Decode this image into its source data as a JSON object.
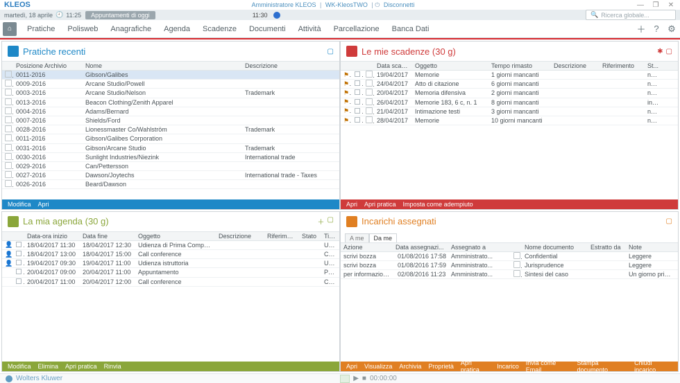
{
  "brand": "KLEOS",
  "topcenter": {
    "admin": "Amministratore KLEOS",
    "ws": "WK-KleosTWO",
    "disconnect": "Disconnetti",
    "disconnect_icon": "⏻"
  },
  "bar2": {
    "date": "martedì, 18 aprile",
    "clock_icon": "🕘",
    "time": "11:25",
    "pill": "Appuntamenti di oggi",
    "time2": "11:30",
    "search_placeholder": "Ricerca globale..."
  },
  "menu": [
    "Pratiche",
    "Polisweb",
    "Anagrafiche",
    "Agenda",
    "Scadenze",
    "Documenti",
    "Attività",
    "Parcellazione",
    "Banca Dati"
  ],
  "panel_recent": {
    "title": "Pratiche recenti",
    "cols": [
      "Posizione Archivio",
      "Nome",
      "Descrizione"
    ],
    "rows": [
      {
        "a": "0011-2016",
        "b": "Gibson/Galibes",
        "c": "",
        "sel": true
      },
      {
        "a": "0009-2016",
        "b": "Arcane Studio/Powell",
        "c": ""
      },
      {
        "a": "0003-2016",
        "b": "Arcane Studio/Nelson",
        "c": "Trademark"
      },
      {
        "a": "0013-2016",
        "b": "Beacon Clothing/Zenith Apparel",
        "c": ""
      },
      {
        "a": "0004-2016",
        "b": "Adams/Bernard",
        "c": ""
      },
      {
        "a": "0007-2016",
        "b": "Shields/Ford",
        "c": ""
      },
      {
        "a": "0028-2016",
        "b": "Lionessmaster Co/Wahlström",
        "c": "Trademark"
      },
      {
        "a": "0011-2016",
        "b": "Gibson/Galibes Corporation",
        "c": ""
      },
      {
        "a": "0031-2016",
        "b": "Gibson/Arcane Studio",
        "c": "Trademark"
      },
      {
        "a": "0030-2016",
        "b": "Sunlight Industries/Niezink",
        "c": "International trade"
      },
      {
        "a": "0029-2016",
        "b": "Can/Pettersson",
        "c": ""
      },
      {
        "a": "0027-2016",
        "b": "Dawson/Joytechs",
        "c": "International trade - Taxes"
      },
      {
        "a": "0026-2016",
        "b": "Beard/Dawson",
        "c": ""
      }
    ],
    "foot": [
      "Modifica",
      "Apri"
    ]
  },
  "panel_deadlines": {
    "title": "Le mie scadenze (30 g)",
    "cols": [
      "Data scad...",
      "Oggetto",
      "Tempo rimasto",
      "Descrizione",
      "Riferimento",
      "St..."
    ],
    "rows": [
      {
        "d": "19/04/2017",
        "o": "Memorie",
        "t": "1 giorni mancanti",
        "s": "no..."
      },
      {
        "d": "24/04/2017",
        "o": "Atto di citazione",
        "t": "6 giorni mancanti",
        "s": "no..."
      },
      {
        "d": "20/04/2017",
        "o": "Memoria difensiva",
        "t": "2 giorni mancanti",
        "s": "no..."
      },
      {
        "d": "26/04/2017",
        "o": "Memorie 183, 6 c, n. 1",
        "t": "8 giorni mancanti",
        "s": "in c..."
      },
      {
        "d": "21/04/2017",
        "o": "Intimazione testi",
        "t": "3 giorni mancanti",
        "s": "no..."
      },
      {
        "d": "28/04/2017",
        "o": "Memorie",
        "t": "10 giorni mancanti",
        "s": "no..."
      }
    ],
    "foot": [
      "Apri",
      "Apri pratica",
      "Imposta come adempiuto"
    ]
  },
  "panel_agenda": {
    "title": "La mia agenda (30 g)",
    "cols": [
      "Data-ora inizio",
      "Data fine",
      "Oggetto",
      "Descrizione",
      "Riferimento",
      "Stato",
      "Tip..."
    ],
    "rows": [
      {
        "a": "18/04/2017 11:30",
        "b": "18/04/2017 12:30",
        "c": "Udienza di Prima Comparizione",
        "t": "Udi..",
        "ic": "r"
      },
      {
        "a": "18/04/2017 13:00",
        "b": "18/04/2017 15:00",
        "c": "Call conference",
        "t": "Cal..",
        "ic": "o"
      },
      {
        "a": "19/04/2017 09:30",
        "b": "19/04/2017 11:00",
        "c": "Udienza istruttoria",
        "t": "Udi..",
        "ic": "r"
      },
      {
        "a": "20/04/2017 09:00",
        "b": "20/04/2017 11:00",
        "c": "Appuntamento",
        "t": "Per..",
        "ic": ""
      },
      {
        "a": "20/04/2017 11:00",
        "b": "20/04/2017 12:00",
        "c": "Call conference",
        "t": "Cal..",
        "ic": ""
      }
    ],
    "foot": [
      "Modifica",
      "Elimina",
      "Apri pratica",
      "Rinvia"
    ]
  },
  "panel_tasks": {
    "title": "Incarichi assegnati",
    "tabs": [
      "A me",
      "Da me"
    ],
    "active_tab": 1,
    "cols": [
      "Azione",
      "Data assegnazi...",
      "Assegnato a",
      "",
      "Nome documento",
      "Estratto da",
      "Note"
    ],
    "rows": [
      {
        "a": "scrivi bozza",
        "d": "01/08/2016 17:58",
        "w": "Amministrato...",
        "n": "Confidential",
        "no": "Leggere",
        "dot": "y"
      },
      {
        "a": "scrivi bozza",
        "d": "01/08/2016 17:59",
        "w": "Amministrato...",
        "n": "Jurisprudence",
        "no": "Leggere",
        "dot": "y"
      },
      {
        "a": "per informazione",
        "d": "02/08/2016 11:23",
        "w": "Amministrato...",
        "n": "Sintesi del caso",
        "no": "Un giorno prima d...",
        "dot": "o"
      }
    ],
    "foot": [
      "Apri",
      "Visualizza",
      "Archivia",
      "Proprietà",
      "Apri pratica",
      "Incarico",
      "Invia come Email",
      "Stampa documento",
      "Chiudi incarico"
    ]
  },
  "footer": {
    "brand": "Wolters Kluwer",
    "time": "00:00:00"
  }
}
